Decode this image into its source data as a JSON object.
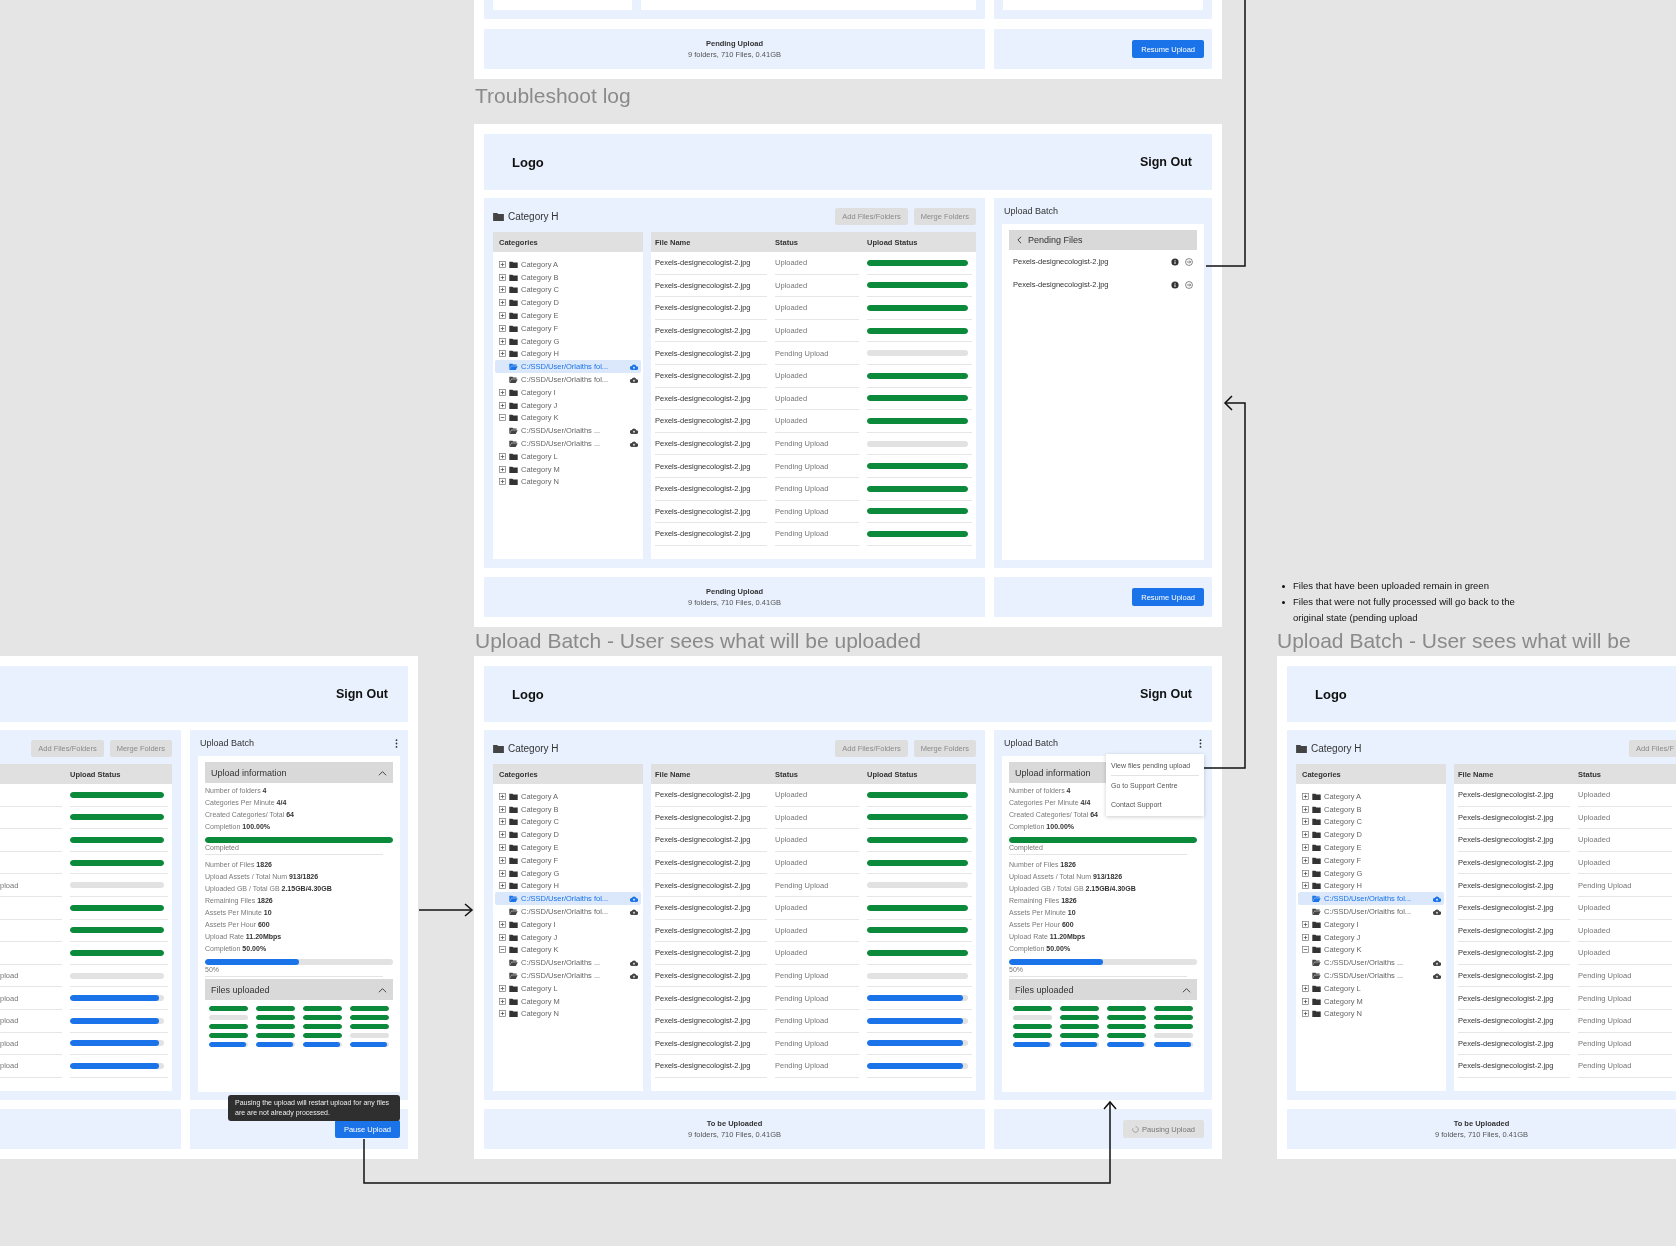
{
  "top_frame": {
    "footer": {
      "title": "Pending Upload",
      "summary": "9 folders, 710 Files, 0.41GB"
    },
    "footer_action": {
      "label": "Resume Upload",
      "kind": "primary"
    }
  },
  "section_titles": [
    "Troubleshoot log",
    "Upload Batch - User sees what will be uploaded",
    "Upload Batch - User sees what will be"
  ],
  "troubleshoot_frame": {
    "header": {
      "logo": "Logo",
      "sign_out": "Sign Out"
    },
    "workspace": {
      "title": "Category H",
      "buttons": [
        "Add Files/Folders",
        "Merge Folders"
      ],
      "tree": {
        "heading": "Categories",
        "items": [
          {
            "label": "Category A",
            "kind": "category",
            "expanded": false,
            "selected": false
          },
          {
            "label": "Category B",
            "kind": "category",
            "expanded": false,
            "selected": false
          },
          {
            "label": "Category C",
            "kind": "category",
            "expanded": false,
            "selected": false
          },
          {
            "label": "Category D",
            "kind": "category",
            "expanded": false,
            "selected": false
          },
          {
            "label": "Category E",
            "kind": "category",
            "expanded": false,
            "selected": false
          },
          {
            "label": "Category F",
            "kind": "category",
            "expanded": false,
            "selected": false
          },
          {
            "label": "Category G",
            "kind": "category",
            "expanded": false,
            "selected": false
          },
          {
            "label": "Category H",
            "kind": "category",
            "expanded": false,
            "selected": false,
            "children": [
              {
                "label": "C:/SSD/User/Orlaiths fol...",
                "kind": "path",
                "selected": true
              },
              {
                "label": "C:/SSD/User/Orlaiths fol...",
                "kind": "path",
                "selected": false
              }
            ]
          },
          {
            "label": "Category I",
            "kind": "category",
            "expanded": false,
            "selected": false
          },
          {
            "label": "Category J",
            "kind": "category",
            "expanded": false,
            "selected": false
          },
          {
            "label": "Category K",
            "kind": "category",
            "expanded": true,
            "selected": false,
            "children": [
              {
                "label": "C:/SSD/User/Orlaiths ...",
                "kind": "path",
                "selected": false
              },
              {
                "label": "C:/SSD/User/Orlaiths ...",
                "kind": "path",
                "selected": false
              }
            ]
          },
          {
            "label": "Category L",
            "kind": "category",
            "expanded": false,
            "selected": false
          },
          {
            "label": "Category M",
            "kind": "category",
            "expanded": false,
            "selected": false
          },
          {
            "label": "Category N",
            "kind": "category",
            "expanded": false,
            "selected": false
          }
        ]
      },
      "table": {
        "columns": [
          {
            "kind": "file",
            "label": "File Name"
          },
          {
            "kind": "status",
            "label": "Status"
          },
          {
            "kind": "progress",
            "label": "Upload Status"
          }
        ],
        "rows": [
          {
            "file": "Pexels-designecologist-2.jpg",
            "status": "Uploaded",
            "level": 1
          },
          {
            "file": "Pexels-designecologist-2.jpg",
            "status": "Uploaded",
            "level": 1
          },
          {
            "file": "Pexels-designecologist-2.jpg",
            "status": "Uploaded",
            "level": 1
          },
          {
            "file": "Pexels-designecologist-2.jpg",
            "status": "Uploaded",
            "level": 1
          },
          {
            "file": "Pexels-designecologist-2.jpg",
            "status": "Pending Upload",
            "level": 0
          },
          {
            "file": "Pexels-designecologist-2.jpg",
            "status": "Uploaded",
            "level": 1
          },
          {
            "file": "Pexels-designecologist-2.jpg",
            "status": "Uploaded",
            "level": 1
          },
          {
            "file": "Pexels-designecologist-2.jpg",
            "status": "Uploaded",
            "level": 1
          },
          {
            "file": "Pexels-designecologist-2.jpg",
            "status": "Pending Upload",
            "level": 0
          },
          {
            "file": "Pexels-designecologist-2.jpg",
            "status": "Pending Upload",
            "level": 1
          },
          {
            "file": "Pexels-designecologist-2.jpg",
            "status": "Pending Upload",
            "level": 1
          },
          {
            "file": "Pexels-designecologist-2.jpg",
            "status": "Pending Upload",
            "level": 1
          },
          {
            "file": "Pexels-designecologist-2.jpg",
            "status": "Pending Upload",
            "level": 1
          }
        ]
      }
    },
    "side_panel": {
      "title": "Upload Batch",
      "kind": "pending_files",
      "pending_files": {
        "title": "Pending Files",
        "files": [
          "Pexels-designecologist-2.jpg",
          "Pexels-designecologist-2.jpg"
        ]
      }
    },
    "footer": {
      "title": "Pending Upload",
      "summary": "9 folders, 710 Files, 0.41GB"
    },
    "footer_action": {
      "label": "Resume Upload",
      "kind": "primary"
    }
  },
  "notes": [
    "Files that have been uploaded remain in green",
    "Files that were not fully processed will go back to the original state (pending upload"
  ],
  "paused_frame": {
    "header": {
      "sign_out": "Sign Out"
    },
    "workspace": {
      "buttons": [
        "Add Files/Folders",
        "Merge Folders"
      ],
      "table": {
        "columns": [
          {
            "kind": "status"
          },
          {
            "kind": "progress",
            "label": "Upload Status"
          }
        ],
        "rows": [
          {
            "level": 1
          },
          {
            "level": 1
          },
          {
            "level": 1
          },
          {
            "level": 1
          },
          {
            "status": "pload",
            "level": 0
          },
          {
            "level": 1
          },
          {
            "level": 1
          },
          {
            "level": 1
          },
          {
            "status": "pload",
            "level": 0
          },
          {
            "status": "pload",
            "level": 0.95
          },
          {
            "status": "pload",
            "level": 0.95
          },
          {
            "status": "pload",
            "level": 0.95
          },
          {
            "status": "pload",
            "level": 0.95
          }
        ]
      }
    },
    "side_panel": {
      "title": "Upload Batch",
      "kind": "upload_info",
      "info": {
        "title": "Upload information",
        "expanded": true,
        "groups": [
          {
            "stats": [
              {
                "label": "Number of folders",
                "value": "4"
              },
              {
                "label": "Categories Per Minute",
                "value": "4/4"
              },
              {
                "label": "Created Categories/ Total",
                "value": "64"
              },
              {
                "label": "Completion",
                "value": "100.00%"
              }
            ],
            "progress": {
              "level": 1,
              "caption": "Completed"
            }
          },
          {
            "stats": [
              {
                "label": "Number of Files",
                "value": "1826"
              },
              {
                "label": "Upload Assets / Total Num",
                "value": "913/1826"
              },
              {
                "label": "Uploaded GB / Total GB",
                "value": "2.15GB/4.30GB"
              },
              {
                "label": "Remaining Files",
                "value": "1826"
              },
              {
                "label": "Assets Per Minute",
                "value": "10"
              },
              {
                "label": "Assets Per Hour",
                "value": "600"
              },
              {
                "label": "Upload Rate",
                "value": "11.20Mbps"
              },
              {
                "label": "Completion",
                "value": "50.00%"
              }
            ],
            "progress": {
              "level": 0.5,
              "caption": "50%"
            }
          }
        ]
      },
      "files_uploaded": {
        "title": "Files uploaded",
        "expanded": true,
        "tiles": [
          {
            "level": 1
          },
          {
            "level": 1
          },
          {
            "level": 1
          },
          {
            "level": 1
          },
          {
            "level": 0
          },
          {
            "level": 1
          },
          {
            "level": 1
          },
          {
            "level": 1
          },
          {
            "level": 1
          },
          {
            "level": 1
          },
          {
            "level": 1
          },
          {
            "level": 1
          },
          {
            "level": 1
          },
          {
            "level": 1
          },
          {
            "level": 1
          },
          {
            "level": 0
          },
          {
            "level": 0.95
          },
          {
            "level": 0.95
          },
          {
            "level": 0.95
          },
          {
            "level": 0.95
          }
        ]
      }
    },
    "footer_action": {
      "label": "Pause Upload",
      "kind": "primary",
      "tooltip": "Pausing the upload will restart upload for any files are are not already processed."
    }
  },
  "pending_frame": {
    "header": {
      "logo": "Logo",
      "sign_out": "Sign Out"
    },
    "workspace": {
      "title": "Category H",
      "buttons": [
        "Add Files/Folders",
        "Merge Folders"
      ],
      "tree": {
        "heading": "Categories",
        "items": [
          {
            "label": "Category A",
            "kind": "category",
            "expanded": false,
            "selected": false
          },
          {
            "label": "Category B",
            "kind": "category",
            "expanded": false,
            "selected": false
          },
          {
            "label": "Category C",
            "kind": "category",
            "expanded": false,
            "selected": false
          },
          {
            "label": "Category D",
            "kind": "category",
            "expanded": false,
            "selected": false
          },
          {
            "label": "Category E",
            "kind": "category",
            "expanded": false,
            "selected": false
          },
          {
            "label": "Category F",
            "kind": "category",
            "expanded": false,
            "selected": false
          },
          {
            "label": "Category G",
            "kind": "category",
            "expanded": false,
            "selected": false
          },
          {
            "label": "Category H",
            "kind": "category",
            "expanded": false,
            "selected": false,
            "children": [
              {
                "label": "C:/SSD/User/Orlaiths fol...",
                "kind": "path",
                "selected": true
              },
              {
                "label": "C:/SSD/User/Orlaiths fol...",
                "kind": "path",
                "selected": false
              }
            ]
          },
          {
            "label": "Category I",
            "kind": "category",
            "expanded": false,
            "selected": false
          },
          {
            "label": "Category J",
            "kind": "category",
            "expanded": false,
            "selected": false
          },
          {
            "label": "Category K",
            "kind": "category",
            "expanded": true,
            "selected": false,
            "children": [
              {
                "label": "C:/SSD/User/Orlaiths ...",
                "kind": "path",
                "selected": false
              },
              {
                "label": "C:/SSD/User/Orlaiths ...",
                "kind": "path",
                "selected": false
              }
            ]
          },
          {
            "label": "Category L",
            "kind": "category",
            "expanded": false,
            "selected": false
          },
          {
            "label": "Category M",
            "kind": "category",
            "expanded": false,
            "selected": false
          },
          {
            "label": "Category N",
            "kind": "category",
            "expanded": false,
            "selected": false
          }
        ]
      },
      "table": {
        "columns": [
          {
            "kind": "file",
            "label": "File Name"
          },
          {
            "kind": "status",
            "label": "Status"
          },
          {
            "kind": "progress",
            "label": "Upload Status"
          }
        ],
        "rows": [
          {
            "file": "Pexels-designecologist-2.jpg",
            "status": "Uploaded",
            "level": 1
          },
          {
            "file": "Pexels-designecologist-2.jpg",
            "status": "Uploaded",
            "level": 1
          },
          {
            "file": "Pexels-designecologist-2.jpg",
            "status": "Uploaded",
            "level": 1
          },
          {
            "file": "Pexels-designecologist-2.jpg",
            "status": "Uploaded",
            "level": 1
          },
          {
            "file": "Pexels-designecologist-2.jpg",
            "status": "Pending Upload",
            "level": 0
          },
          {
            "file": "Pexels-designecologist-2.jpg",
            "status": "Uploaded",
            "level": 1
          },
          {
            "file": "Pexels-designecologist-2.jpg",
            "status": "Uploaded",
            "level": 1
          },
          {
            "file": "Pexels-designecologist-2.jpg",
            "status": "Uploaded",
            "level": 1
          },
          {
            "file": "Pexels-designecologist-2.jpg",
            "status": "Pending Upload",
            "level": 0
          },
          {
            "file": "Pexels-designecologist-2.jpg",
            "status": "Pending Upload",
            "level": 0.95
          },
          {
            "file": "Pexels-designecologist-2.jpg",
            "status": "Pending Upload",
            "level": 0.95
          },
          {
            "file": "Pexels-designecologist-2.jpg",
            "status": "Pending Upload",
            "level": 0.95
          },
          {
            "file": "Pexels-designecologist-2.jpg",
            "status": "Pending Upload",
            "level": 0.95
          }
        ]
      }
    },
    "side_panel": {
      "title": "Upload Batch",
      "kind": "upload_info",
      "info": {
        "title": "Upload information",
        "groups": [
          {
            "stats": [
              {
                "label": "Number of folders",
                "value": "4"
              },
              {
                "label": "Categories Per Minute",
                "value": "4/4"
              },
              {
                "label": "Created Categories/ Total",
                "value": "64"
              },
              {
                "label": "Completion",
                "value": "100.00%"
              }
            ],
            "progress": {
              "level": 1,
              "caption": "Completed"
            }
          },
          {
            "stats": [
              {
                "label": "Number of Files",
                "value": "1826"
              },
              {
                "label": "Upload Assets / Total Num",
                "value": "913/1826"
              },
              {
                "label": "Uploaded GB / Total GB",
                "value": "2.15GB/4.30GB"
              },
              {
                "label": "Remaining Files",
                "value": "1826"
              },
              {
                "label": "Assets Per Minute",
                "value": "10"
              },
              {
                "label": "Assets Per Hour",
                "value": "600"
              },
              {
                "label": "Upload Rate",
                "value": "11.20Mbps"
              },
              {
                "label": "Completion",
                "value": "50.00%"
              }
            ],
            "progress": {
              "level": 0.5,
              "caption": "50%"
            }
          }
        ]
      },
      "files_uploaded": {
        "title": "Files uploaded",
        "expanded": true,
        "tiles": [
          {
            "level": 1
          },
          {
            "level": 1
          },
          {
            "level": 1
          },
          {
            "level": 1
          },
          {
            "level": 0
          },
          {
            "level": 1
          },
          {
            "level": 1
          },
          {
            "level": 1
          },
          {
            "level": 1
          },
          {
            "level": 1
          },
          {
            "level": 1
          },
          {
            "level": 1
          },
          {
            "level": 1
          },
          {
            "level": 1
          },
          {
            "level": 1
          },
          {
            "level": 0
          },
          {
            "level": 0.95
          },
          {
            "level": 0.95
          },
          {
            "level": 0.95
          },
          {
            "level": 0.95
          }
        ]
      },
      "menu": {
        "items": [
          "View files pending upload",
          "Go to Support Centre",
          "Contact Support"
        ]
      }
    },
    "footer": {
      "title": "To be Uploaded",
      "summary": "9 folders, 710 Files, 0.41GB"
    },
    "footer_action": {
      "label": "Pausing Upload",
      "kind": "busy"
    }
  },
  "preview_frame": {
    "header": {
      "logo": "Logo"
    },
    "workspace": {
      "title": "Category H",
      "buttons": [
        "Add Files/F"
      ],
      "tree": {
        "heading": "Categories",
        "items": [
          {
            "label": "Category A",
            "kind": "category",
            "expanded": false,
            "selected": false
          },
          {
            "label": "Category B",
            "kind": "category",
            "expanded": false,
            "selected": false
          },
          {
            "label": "Category C",
            "kind": "category",
            "expanded": false,
            "selected": false
          },
          {
            "label": "Category D",
            "kind": "category",
            "expanded": false,
            "selected": false
          },
          {
            "label": "Category E",
            "kind": "category",
            "expanded": false,
            "selected": false
          },
          {
            "label": "Category F",
            "kind": "category",
            "expanded": false,
            "selected": false
          },
          {
            "label": "Category G",
            "kind": "category",
            "expanded": false,
            "selected": false
          },
          {
            "label": "Category H",
            "kind": "category",
            "expanded": false,
            "selected": false,
            "children": [
              {
                "label": "C:/SSD/User/Orlaiths fol...",
                "kind": "path",
                "selected": true
              },
              {
                "label": "C:/SSD/User/Orlaiths fol...",
                "kind": "path",
                "selected": false
              }
            ]
          },
          {
            "label": "Category I",
            "kind": "category",
            "expanded": false,
            "selected": false
          },
          {
            "label": "Category J",
            "kind": "category",
            "expanded": false,
            "selected": false
          },
          {
            "label": "Category K",
            "kind": "category",
            "expanded": true,
            "selected": false,
            "children": [
              {
                "label": "C:/SSD/User/Orlaiths ...",
                "kind": "path",
                "selected": false
              },
              {
                "label": "C:/SSD/User/Orlaiths ...",
                "kind": "path",
                "selected": false
              }
            ]
          },
          {
            "label": "Category L",
            "kind": "category",
            "expanded": false,
            "selected": false
          },
          {
            "label": "Category M",
            "kind": "category",
            "expanded": false,
            "selected": false
          },
          {
            "label": "Category N",
            "kind": "category",
            "expanded": false,
            "selected": false
          }
        ]
      },
      "table": {
        "columns": [
          {
            "kind": "file",
            "label": "File Name"
          },
          {
            "kind": "status",
            "label": "Status"
          }
        ],
        "rows": [
          {
            "file": "Pexels-designecologist-2.jpg",
            "status": "Uploaded"
          },
          {
            "file": "Pexels-designecologist-2.jpg",
            "status": "Uploaded"
          },
          {
            "file": "Pexels-designecologist-2.jpg",
            "status": "Uploaded"
          },
          {
            "file": "Pexels-designecologist-2.jpg",
            "status": "Uploaded"
          },
          {
            "file": "Pexels-designecologist-2.jpg",
            "status": "Pending Upload"
          },
          {
            "file": "Pexels-designecologist-2.jpg",
            "status": "Uploaded"
          },
          {
            "file": "Pexels-designecologist-2.jpg",
            "status": "Uploaded"
          },
          {
            "file": "Pexels-designecologist-2.jpg",
            "status": "Uploaded"
          },
          {
            "file": "Pexels-designecologist-2.jpg",
            "status": "Pending Upload"
          },
          {
            "file": "Pexels-designecologist-2.jpg",
            "status": "Pending Upload"
          },
          {
            "file": "Pexels-designecologist-2.jpg",
            "status": "Pending Upload"
          },
          {
            "file": "Pexels-designecologist-2.jpg",
            "status": "Pending Upload"
          },
          {
            "file": "Pexels-designecologist-2.jpg",
            "status": "Pending Upload"
          }
        ]
      }
    },
    "footer": {
      "title": "To be Uploaded",
      "summary": "9 folders, 710 Files, 0.41GB"
    }
  }
}
